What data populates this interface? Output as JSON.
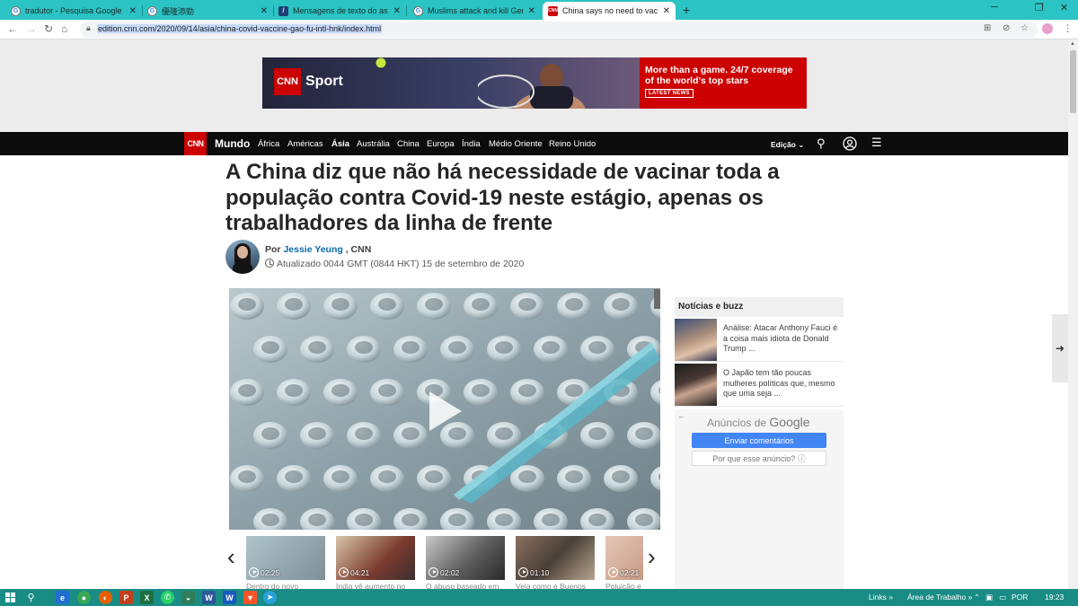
{
  "browser": {
    "tabs": [
      {
        "title": "tradutor - Pesquisa Google",
        "active": false,
        "favicon": "google-icon"
      },
      {
        "title": "優隆添勁",
        "active": false,
        "favicon": "google-icon"
      },
      {
        "title": "Mensagens de texto do associad",
        "active": false,
        "favicon": "site-icon"
      },
      {
        "title": "Muslims attack and kill Germans",
        "active": false,
        "favicon": "google-icon"
      },
      {
        "title": "China says no need to vaccinate",
        "active": true,
        "favicon": "cnn-icon"
      }
    ],
    "address": "edition.cnn.com/2020/09/14/asia/china-covid-vaccine-gao-fu-intl-hnk/index.html"
  },
  "ad": {
    "logo": "CNN",
    "brand": "Sport",
    "headline": "More than a game. 24/7 coverage of the world's top stars",
    "cta": "LATEST NEWS"
  },
  "nav": {
    "logo": "CNN",
    "section": "Mundo",
    "items": [
      "África",
      "Américas",
      "Ásia",
      "Austrália",
      "China",
      "Europa",
      "Índia",
      "Médio Oriente",
      "Reino Unido"
    ],
    "active_item": "Ásia",
    "edition": "Edição"
  },
  "article": {
    "headline": "A China diz que não há necessidade de vacinar toda a população contra Covid-19 neste estágio, apenas os trabalhadores da linha de frente",
    "by": "Por",
    "author": "Jessie Yeung",
    "source": ", CNN",
    "updated": "Atualizado 0044 GMT (0844 HKT) 15 de setembro de 2020"
  },
  "video_strip": [
    {
      "duration": "02:25",
      "caption": "Dentro do novo"
    },
    {
      "duration": "04:21",
      "caption": "Índia vê aumento no"
    },
    {
      "duration": "02:02",
      "caption": "O abuso baseado em"
    },
    {
      "duration": "01:10",
      "caption": "Veja como é Buenos"
    },
    {
      "duration": "02:21",
      "caption": "Poluição e"
    }
  ],
  "news_buzz": {
    "title": "Notícias e buzz",
    "items": [
      {
        "text": "Análise: Atacar Anthony Fauci é a coisa mais idiota de Donald Trump ..."
      },
      {
        "text": "O Japão tem tão poucas mulheres políticas que, mesmo que uma seja ..."
      }
    ]
  },
  "ads_panel": {
    "title_prefix": "Anúncios de",
    "title_brand": "Google",
    "send_feedback": "Enviar comentários",
    "why_ad": "Por que esse anúncio? ⓘ"
  },
  "taskbar": {
    "links": "Links",
    "desktop": "Área de Trabalho",
    "language": "POR",
    "time": "19:23"
  },
  "colors": {
    "tabbar": "#2bc3c3",
    "cnn_red": "#cc0000",
    "nav_bg": "#0c0c0c",
    "author_link": "#0c6aa8",
    "taskbar": "#1a8c86",
    "google_blue": "#4285f4"
  }
}
